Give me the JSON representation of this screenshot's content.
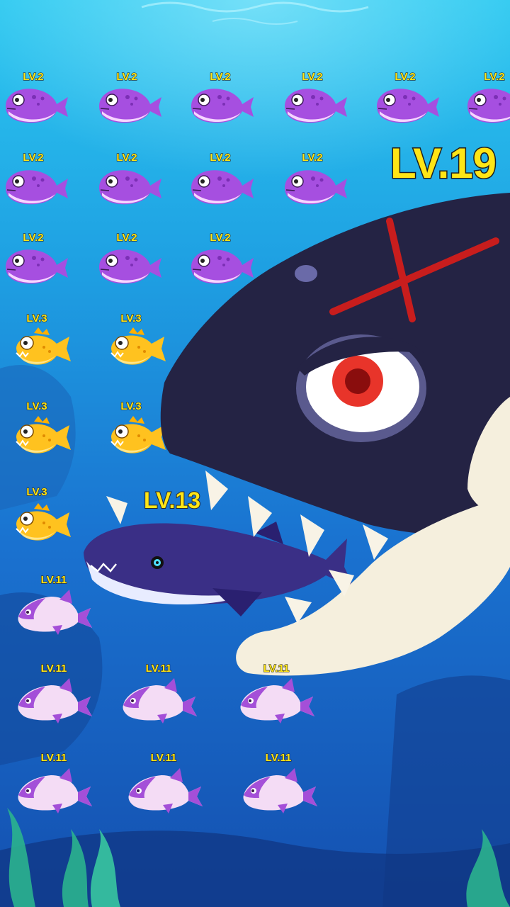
{
  "scene": {
    "palette": {
      "water_top": "#2cc8f0",
      "water_bottom": "#1450b0",
      "level_text": "#ffe516"
    },
    "boss": {
      "level": "LV.19",
      "kind": "orca",
      "mark": "red-x-scar"
    },
    "rival": {
      "level": "LV.13",
      "kind": "blue-whale"
    },
    "fish_groups": [
      {
        "level": "LV.2",
        "kind": "purple-pufferfish",
        "count": 13
      },
      {
        "level": "LV.3",
        "kind": "yellow-piranha",
        "count": 5
      },
      {
        "level": "LV.11",
        "kind": "purple-shark-fish",
        "count": 7
      }
    ],
    "labels": {
      "r1": [
        "LV.2",
        "LV.2",
        "LV.2",
        "LV.2",
        "LV.2",
        "LV.2"
      ],
      "r2": [
        "LV.2",
        "LV.2",
        "LV.2",
        "LV.2"
      ],
      "r3": [
        "LV.2",
        "LV.2",
        "LV.2"
      ],
      "r4": [
        "LV.3",
        "LV.3"
      ],
      "r5": [
        "LV.3",
        "LV.3"
      ],
      "r6": [
        "LV.3"
      ],
      "r7": [
        "LV.11"
      ],
      "r8": [
        "LV.11",
        "LV.11",
        "LV.11"
      ],
      "r9": [
        "LV.11",
        "LV.11",
        "LV.11"
      ]
    }
  }
}
